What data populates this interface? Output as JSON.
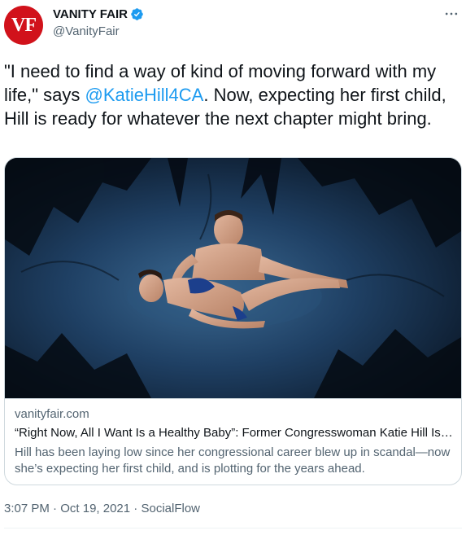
{
  "account": {
    "avatar_text": "VF",
    "display_name": "VANITY FAIR",
    "handle": "@VanityFair",
    "verified": true
  },
  "tweet": {
    "text_before": "\"I need to find a way of kind of moving forward with my life,\" says ",
    "mention": "@KatieHill4CA",
    "text_after": ". Now, expecting her first child, Hill is ready for whatever the next chapter might bring."
  },
  "card": {
    "domain": "vanityfair.com",
    "title": "“Right Now, All I Want Is a Healthy Baby”: Former Congresswoman Katie Hill Is…",
    "description": "Hill has been laying low since her congressional career blew up in scandal—now she’s expecting her first child, and is plotting for the years ahead."
  },
  "meta": {
    "time": "3:07 PM",
    "separator": " · ",
    "date": "Oct 19, 2021",
    "source": "SocialFlow"
  },
  "colors": {
    "brand_red": "#d1121b",
    "link_blue": "#1d9bf0",
    "verified_blue": "#1d9bf0"
  },
  "icons": {
    "verified": "verified-badge-icon",
    "more": "more-horizontal-icon"
  }
}
